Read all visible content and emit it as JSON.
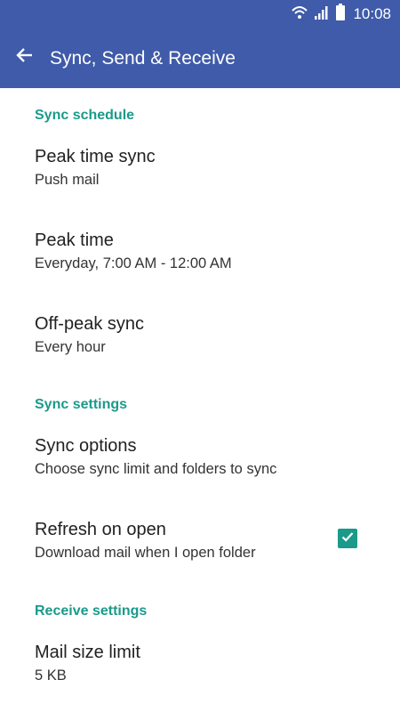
{
  "status_bar": {
    "time": "10:08",
    "icons": [
      "wifi-icon",
      "signal-icon",
      "battery-icon"
    ]
  },
  "app_bar": {
    "back_icon": "arrow-left-icon",
    "title": "Sync, Send & Receive"
  },
  "sections": {
    "sync_schedule": {
      "header": "Sync schedule",
      "peak_time_sync": {
        "title": "Peak time sync",
        "summary": "Push mail"
      },
      "peak_time": {
        "title": "Peak time",
        "summary": "Everyday, 7:00 AM - 12:00 AM"
      },
      "off_peak_sync": {
        "title": "Off-peak sync",
        "summary": "Every hour"
      }
    },
    "sync_settings": {
      "header": "Sync settings",
      "sync_options": {
        "title": "Sync options",
        "summary": "Choose sync limit and folders to sync"
      },
      "refresh_on_open": {
        "title": "Refresh on open",
        "summary": "Download mail when I open folder",
        "checked": true
      }
    },
    "receive_settings": {
      "header": "Receive settings",
      "mail_size_limit": {
        "title": "Mail size limit",
        "summary": "5 KB"
      }
    }
  },
  "colors": {
    "app_bar": "#3f5ba9",
    "accent": "#1a9a8a",
    "title_text": "#212121",
    "summary_text": "#333333"
  }
}
